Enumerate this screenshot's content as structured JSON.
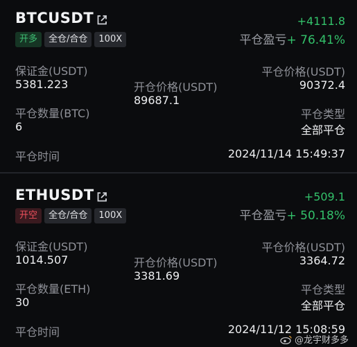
{
  "positions": [
    {
      "symbol": "BTCUSDT",
      "side": "开多",
      "margin_mode": "全仓/合仓",
      "leverage": "100X",
      "pnl_amount": "+4111.8",
      "pnl_label": "平仓盈亏",
      "pnl_pct": "+ 76.41%",
      "margin_label": "保证金(USDT)",
      "margin_value": "5381.223",
      "open_price_label": "开仓价格(USDT)",
      "open_price_value": "89687.1",
      "close_price_label": "平仓价格(USDT)",
      "close_price_value": "90372.4",
      "qty_label": "平仓数量(BTC)",
      "qty_value": "6",
      "close_type_label": "平仓类型",
      "close_type_value": "全部平仓",
      "close_time_label": "平仓时间",
      "close_time_value": "2024/11/14 15:49:37"
    },
    {
      "symbol": "ETHUSDT",
      "side": "开空",
      "margin_mode": "全仓/合仓",
      "leverage": "100X",
      "pnl_amount": "+509.1",
      "pnl_label": "平仓盈亏",
      "pnl_pct": "+ 50.18%",
      "margin_label": "保证金(USDT)",
      "margin_value": "1014.507",
      "open_price_label": "开仓价格(USDT)",
      "open_price_value": "3381.69",
      "close_price_label": "平仓价格(USDT)",
      "close_price_value": "3364.72",
      "qty_label": "平仓数量(ETH)",
      "qty_value": "30",
      "close_type_label": "平仓类型",
      "close_type_value": "全部平仓",
      "close_time_label": "平仓时间",
      "close_time_value": "2024/11/12 15:08:59"
    }
  ],
  "watermark": {
    "text": "@龙宇财多多",
    "icon": "weibo-icon"
  },
  "colors": {
    "profit": "#33c16a",
    "long": "#3fbe74",
    "short": "#f0505c",
    "background": "#0b0c0e"
  }
}
